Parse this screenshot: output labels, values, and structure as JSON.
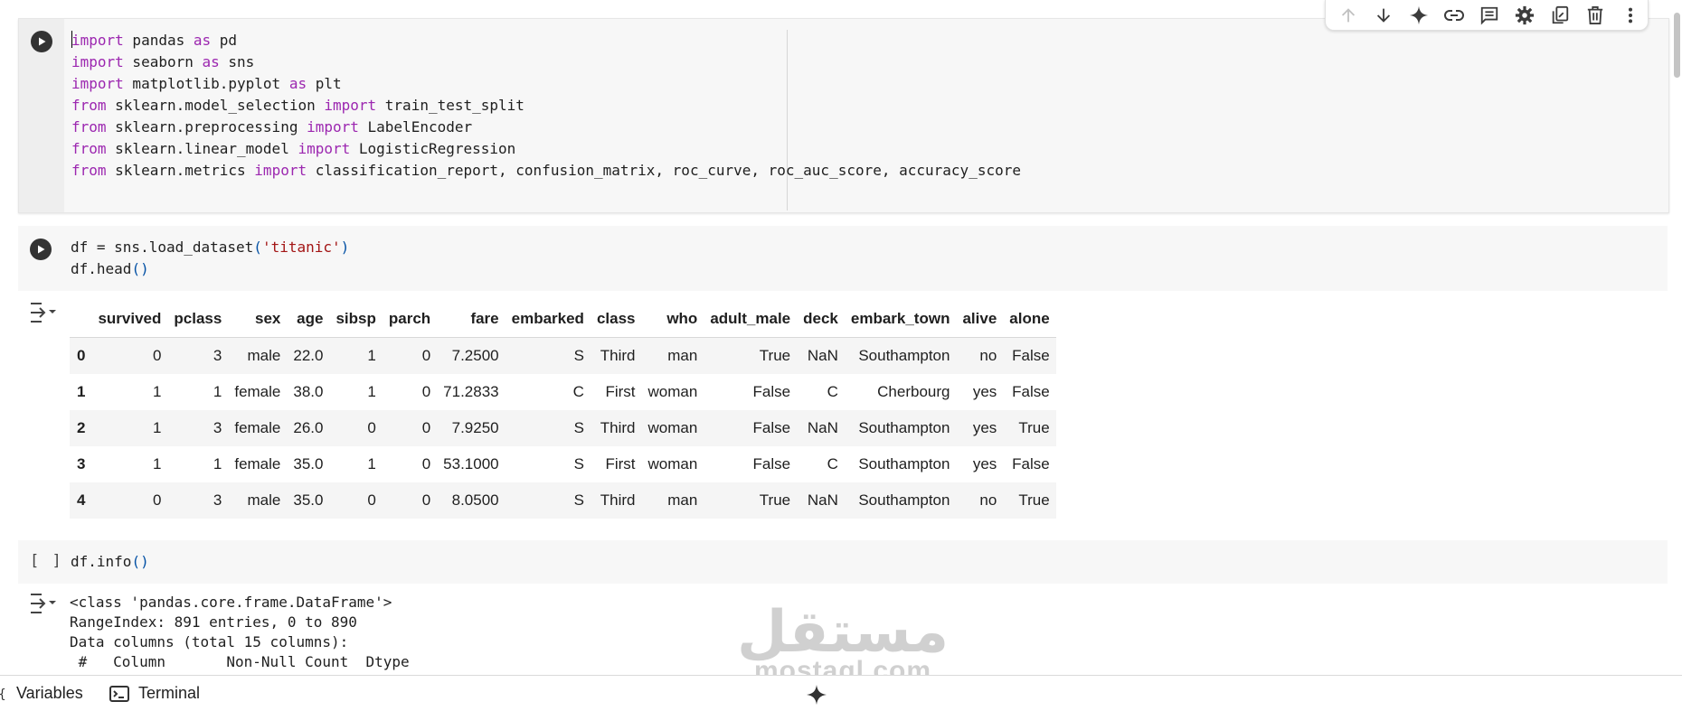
{
  "toolbar": {
    "buttons": [
      {
        "name": "move-cell-up",
        "icon": "arrow-up-icon"
      },
      {
        "name": "move-cell-down",
        "icon": "arrow-down-icon"
      },
      {
        "name": "gemini",
        "icon": "sparkle-icon"
      },
      {
        "name": "copy-link",
        "icon": "link-icon"
      },
      {
        "name": "add-comment",
        "icon": "comment-icon"
      },
      {
        "name": "cell-settings",
        "icon": "gear-icon"
      },
      {
        "name": "mirror-cell",
        "icon": "mirror-icon"
      },
      {
        "name": "delete-cell",
        "icon": "trash-icon"
      },
      {
        "name": "more-actions",
        "icon": "more-vert-icon"
      }
    ]
  },
  "cells": {
    "imports": {
      "lines": [
        [
          {
            "t": "import",
            "c": "kw"
          },
          {
            "t": " pandas "
          },
          {
            "t": "as",
            "c": "kw"
          },
          {
            "t": " pd"
          }
        ],
        [
          {
            "t": "import",
            "c": "kw"
          },
          {
            "t": " seaborn "
          },
          {
            "t": "as",
            "c": "kw"
          },
          {
            "t": " sns"
          }
        ],
        [
          {
            "t": "import",
            "c": "kw"
          },
          {
            "t": " matplotlib.pyplot "
          },
          {
            "t": "as",
            "c": "kw"
          },
          {
            "t": " plt"
          }
        ],
        [
          {
            "t": "from",
            "c": "kw"
          },
          {
            "t": " sklearn.model_selection "
          },
          {
            "t": "import",
            "c": "kw"
          },
          {
            "t": " train_test_split"
          }
        ],
        [
          {
            "t": "from",
            "c": "kw"
          },
          {
            "t": " sklearn.preprocessing "
          },
          {
            "t": "import",
            "c": "kw"
          },
          {
            "t": " LabelEncoder"
          }
        ],
        [
          {
            "t": "from",
            "c": "kw"
          },
          {
            "t": " sklearn.linear_model "
          },
          {
            "t": "import",
            "c": "kw"
          },
          {
            "t": " LogisticRegression"
          }
        ],
        [
          {
            "t": "from",
            "c": "kw"
          },
          {
            "t": " sklearn.metrics "
          },
          {
            "t": "import",
            "c": "kw"
          },
          {
            "t": " classification_report, confusion_matrix, roc_curve, roc_auc_score, accuracy_score"
          }
        ]
      ]
    },
    "load": {
      "lines": [
        [
          {
            "t": "df = sns.load_dataset"
          },
          {
            "t": "(",
            "c": "par"
          },
          {
            "t": "'titanic'",
            "c": "str"
          },
          {
            "t": ")",
            "c": "par"
          }
        ],
        [
          {
            "t": "df.head"
          },
          {
            "t": "()",
            "c": "par"
          }
        ]
      ]
    },
    "info": {
      "run_label": "[ ]",
      "lines": [
        [
          {
            "t": "df.info"
          },
          {
            "t": "()",
            "c": "par"
          }
        ]
      ]
    }
  },
  "dataframe": {
    "columns": [
      "",
      "survived",
      "pclass",
      "sex",
      "age",
      "sibsp",
      "parch",
      "fare",
      "embarked",
      "class",
      "who",
      "adult_male",
      "deck",
      "embark_town",
      "alive",
      "alone"
    ],
    "rows": [
      [
        "0",
        "0",
        "3",
        "male",
        "22.0",
        "1",
        "0",
        "7.2500",
        "S",
        "Third",
        "man",
        "True",
        "NaN",
        "Southampton",
        "no",
        "False"
      ],
      [
        "1",
        "1",
        "1",
        "female",
        "38.0",
        "1",
        "0",
        "71.2833",
        "C",
        "First",
        "woman",
        "False",
        "C",
        "Cherbourg",
        "yes",
        "False"
      ],
      [
        "2",
        "1",
        "3",
        "female",
        "26.0",
        "0",
        "0",
        "7.9250",
        "S",
        "Third",
        "woman",
        "False",
        "NaN",
        "Southampton",
        "yes",
        "True"
      ],
      [
        "3",
        "1",
        "1",
        "female",
        "35.0",
        "1",
        "0",
        "53.1000",
        "S",
        "First",
        "woman",
        "False",
        "C",
        "Southampton",
        "yes",
        "False"
      ],
      [
        "4",
        "0",
        "3",
        "male",
        "35.0",
        "0",
        "0",
        "8.0500",
        "S",
        "Third",
        "man",
        "True",
        "NaN",
        "Southampton",
        "no",
        "True"
      ]
    ]
  },
  "info_output": {
    "lines": [
      "<class 'pandas.core.frame.DataFrame'>",
      "RangeIndex: 891 entries, 0 to 890",
      "Data columns (total 15 columns):",
      " #   Column       Non-Null Count  Dtype"
    ]
  },
  "bottombar": {
    "variables_label": "Variables",
    "terminal_label": "Terminal"
  },
  "watermark": {
    "arabic": "مستقل",
    "latin": "mostaql.com"
  },
  "colors": {
    "keyword": "#9c27b0",
    "string": "#a31515",
    "paren": "#0451a5",
    "cell_bg": "#f7f7f7"
  }
}
